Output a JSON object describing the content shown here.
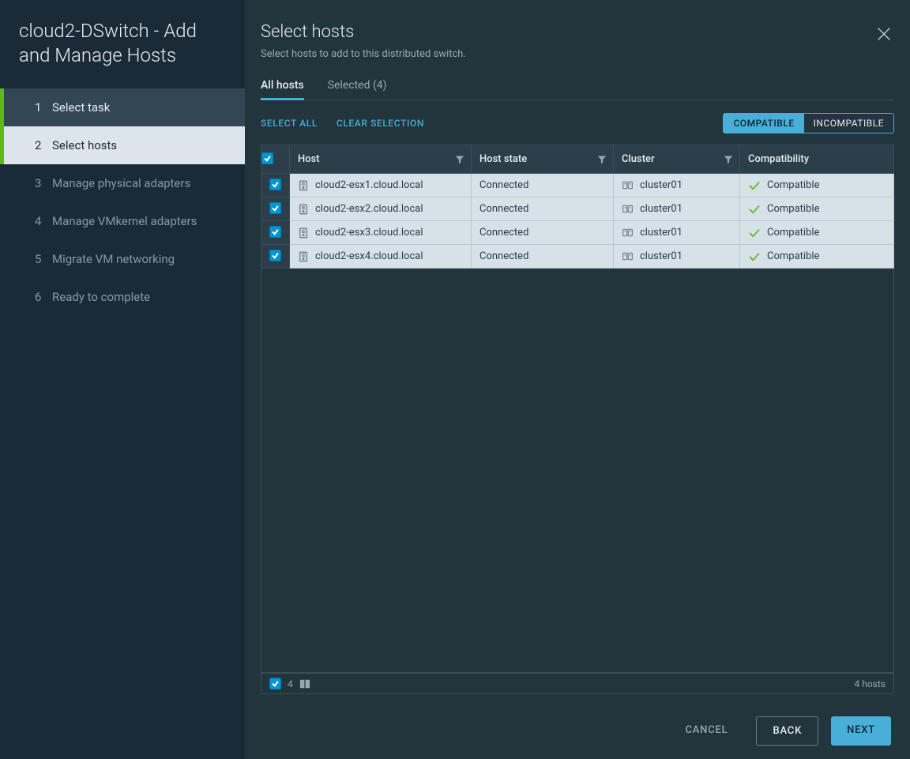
{
  "wizard": {
    "title": "cloud2-DSwitch - Add and Manage Hosts",
    "steps": [
      {
        "num": "1",
        "label": "Select task"
      },
      {
        "num": "2",
        "label": "Select hosts"
      },
      {
        "num": "3",
        "label": "Manage physical adapters"
      },
      {
        "num": "4",
        "label": "Manage VMkernel adapters"
      },
      {
        "num": "5",
        "label": "Migrate VM networking"
      },
      {
        "num": "6",
        "label": "Ready to complete"
      }
    ]
  },
  "main": {
    "title": "Select hosts",
    "subtitle": "Select hosts to add to this distributed switch.",
    "tabs": {
      "all": "All hosts",
      "selected": "Selected (4)"
    },
    "toolbar": {
      "select_all": "SELECT ALL",
      "clear": "CLEAR SELECTION",
      "compatible": "COMPATIBLE",
      "incompatible": "INCOMPATIBLE"
    },
    "columns": {
      "host": "Host",
      "state": "Host state",
      "cluster": "Cluster",
      "compat": "Compatibility"
    },
    "rows": [
      {
        "host": "cloud2-esx1.cloud.local",
        "state": "Connected",
        "cluster": "cluster01",
        "compat": "Compatible"
      },
      {
        "host": "cloud2-esx2.cloud.local",
        "state": "Connected",
        "cluster": "cluster01",
        "compat": "Compatible"
      },
      {
        "host": "cloud2-esx3.cloud.local",
        "state": "Connected",
        "cluster": "cluster01",
        "compat": "Compatible"
      },
      {
        "host": "cloud2-esx4.cloud.local",
        "state": "Connected",
        "cluster": "cluster01",
        "compat": "Compatible"
      }
    ],
    "footer": {
      "selected_count": "4",
      "total": "4 hosts"
    }
  },
  "actions": {
    "cancel": "CANCEL",
    "back": "BACK",
    "next": "NEXT"
  }
}
